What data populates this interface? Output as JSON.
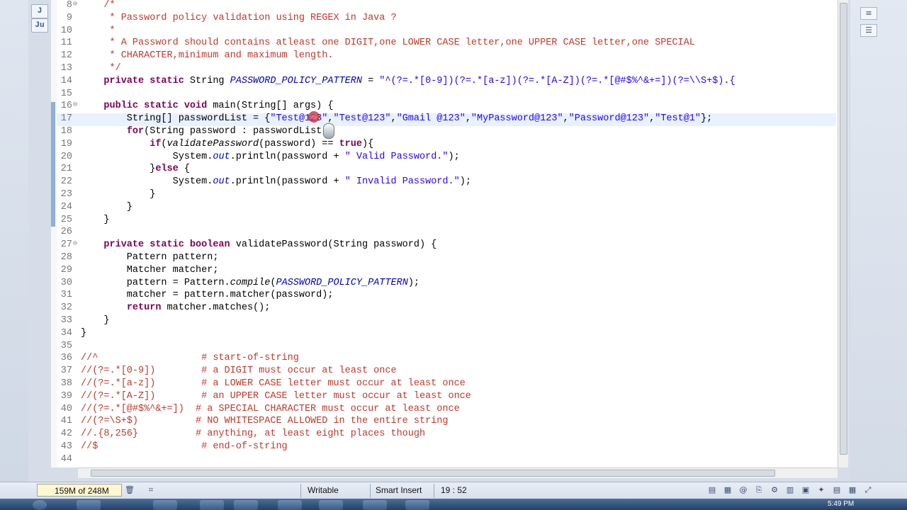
{
  "editor": {
    "lines": [
      {
        "n": "8",
        "fold": "⊖",
        "html": "<span class='jd'>/*</span>"
      },
      {
        "n": "9",
        "html": "<span class='jd'> * Password policy validation using REGEX in Java ?</span>"
      },
      {
        "n": "10",
        "html": "<span class='jd'> *</span>"
      },
      {
        "n": "11",
        "html": "<span class='jd'> * A Password should contains atleast one DIGIT,one LOWER CASE letter,one UPPER CASE letter,one SPECIAL</span>"
      },
      {
        "n": "12",
        "html": "<span class='jd'> * CHARACTER,minimum and maximum length.</span>"
      },
      {
        "n": "13",
        "html": "<span class='jd'> */</span>"
      },
      {
        "n": "14",
        "html": "<span class='kw'>private static</span> String <span class='fld'>PASSWORD_POLICY_PATTERN</span> = <span class='str'>\"^(?=.*[0-9])(?=.*[a-z])(?=.*[A-Z])(?=.*[@#$%^&amp;+=])(?=\\\\S+$).{</span>"
      },
      {
        "n": "15",
        "html": ""
      },
      {
        "n": "16",
        "fold": "⊖",
        "html": "<span class='kw'>public static void</span> main(String[] args) {"
      },
      {
        "n": "17",
        "cur": true,
        "html": "    String[] passwordList = {<span class='str'>\"Test@123\"</span>,<span class='str'>\"Test@123\"</span>,<span class='str'>\"Gmail @123\"</span>,<span class='str'>\"MyPassword@123\"</span>,<span class='str'>\"Password@123\"</span>,<span class='str'>\"Test@1\"</span>};"
      },
      {
        "n": "18",
        "html": "    <span class='kw'>for</span>(String password : passwordList){"
      },
      {
        "n": "19",
        "html": "        <span class='kw'>if</span>(<span class='it'>validatePassword</span>(password) == <span class='kw'>true</span>){"
      },
      {
        "n": "20",
        "html": "            System.<span class='fld'>out</span>.println(password + <span class='str'>\" Valid Password.\"</span>);"
      },
      {
        "n": "21",
        "html": "        }<span class='kw'>else</span> {"
      },
      {
        "n": "22",
        "html": "            System.<span class='fld'>out</span>.println(password + <span class='str'>\" Invalid Password.\"</span>);"
      },
      {
        "n": "23",
        "html": "        }"
      },
      {
        "n": "24",
        "html": "    }"
      },
      {
        "n": "25",
        "html": "}"
      },
      {
        "n": "26",
        "html": ""
      },
      {
        "n": "27",
        "fold": "⊖",
        "html": "<span class='kw'>private static boolean</span> validatePassword(String password) {"
      },
      {
        "n": "28",
        "html": "    Pattern pattern;"
      },
      {
        "n": "29",
        "html": "    Matcher matcher;"
      },
      {
        "n": "30",
        "html": "    pattern = Pattern.<span class='it'>compile</span>(<span class='fld'>PASSWORD_POLICY_PATTERN</span>);"
      },
      {
        "n": "31",
        "html": "    matcher = pattern.matcher(password);"
      },
      {
        "n": "32",
        "html": "    <span class='kw'>return</span> matcher.matches();"
      },
      {
        "n": "33",
        "html": "}"
      },
      {
        "n": "34",
        "html": "}"
      },
      {
        "n": "35",
        "html": ""
      },
      {
        "n": "36",
        "html": "<span class='cm'>//^                  # start-of-string</span>"
      },
      {
        "n": "37",
        "html": "<span class='cm'>//(?=.*[0-9])        # a DIGIT must occur at least once</span>"
      },
      {
        "n": "38",
        "html": "<span class='cm'>//(?=.*[a-z])        # a LOWER CASE letter must occur at least once</span>"
      },
      {
        "n": "39",
        "html": "<span class='cm'>//(?=.*[A-Z])        # an UPPER CASE letter must occur at least once</span>"
      },
      {
        "n": "40",
        "html": "<span class='cm'>//(?=.*[@#$%^&amp;+=])  # a SPECIAL CHARACTER must occur at least once</span>"
      },
      {
        "n": "41",
        "html": "<span class='cm'>//(?=\\S+$)          # NO WHITESPACE ALLOWED in the entire string</span>"
      },
      {
        "n": "42",
        "html": "<span class='cm'>//.{8,256}          # anything, at least eight places though</span>"
      },
      {
        "n": "43",
        "html": "<span class='cm'>//$                  # end-of-string</span>"
      },
      {
        "n": "44",
        "html": ""
      }
    ]
  },
  "indent": {
    "8": "    ",
    "9": "    ",
    "10": "    ",
    "11": "    ",
    "12": "    ",
    "13": "    ",
    "14": "    ",
    "16": "    ",
    "17": "    ",
    "18": "    ",
    "19": "    ",
    "20": "    ",
    "21": "    ",
    "22": "    ",
    "23": "    ",
    "24": "    ",
    "25": "    ",
    "27": "    ",
    "28": "    ",
    "29": "    ",
    "30": "    ",
    "31": "    ",
    "32": "    ",
    "33": "    ",
    "34": ""
  },
  "status": {
    "heap": "159M of 248M",
    "mode_writable": "Writable",
    "mode_insert": "Smart Insert",
    "position": "19 : 52",
    "clock": "5:49 PM"
  },
  "side_icons": {
    "left_top": "J",
    "left_second": "Ju",
    "right_top": "≡"
  }
}
